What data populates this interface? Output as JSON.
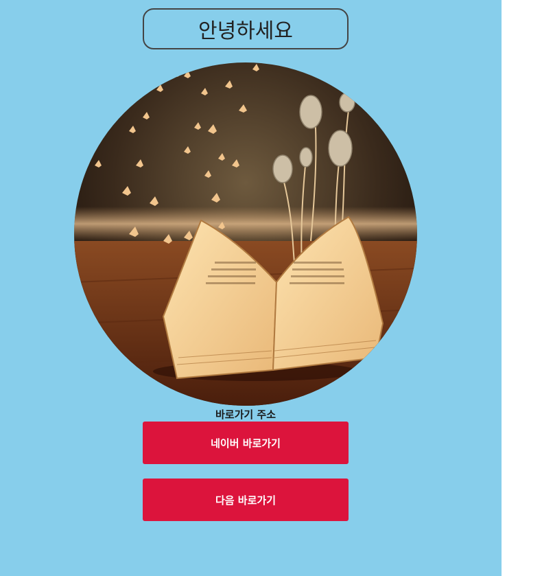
{
  "header": {
    "title": "안녕하세요"
  },
  "hero": {
    "image_subject": "open book with butterflies and roses"
  },
  "links": {
    "heading": "바로가기 주소",
    "buttons": [
      {
        "label": "네이버 바로가기"
      },
      {
        "label": "다음 바로가기"
      }
    ]
  },
  "colors": {
    "background": "#87ceeb",
    "button": "#dc143c",
    "button_text": "#ffffff",
    "title_border": "#444444"
  }
}
